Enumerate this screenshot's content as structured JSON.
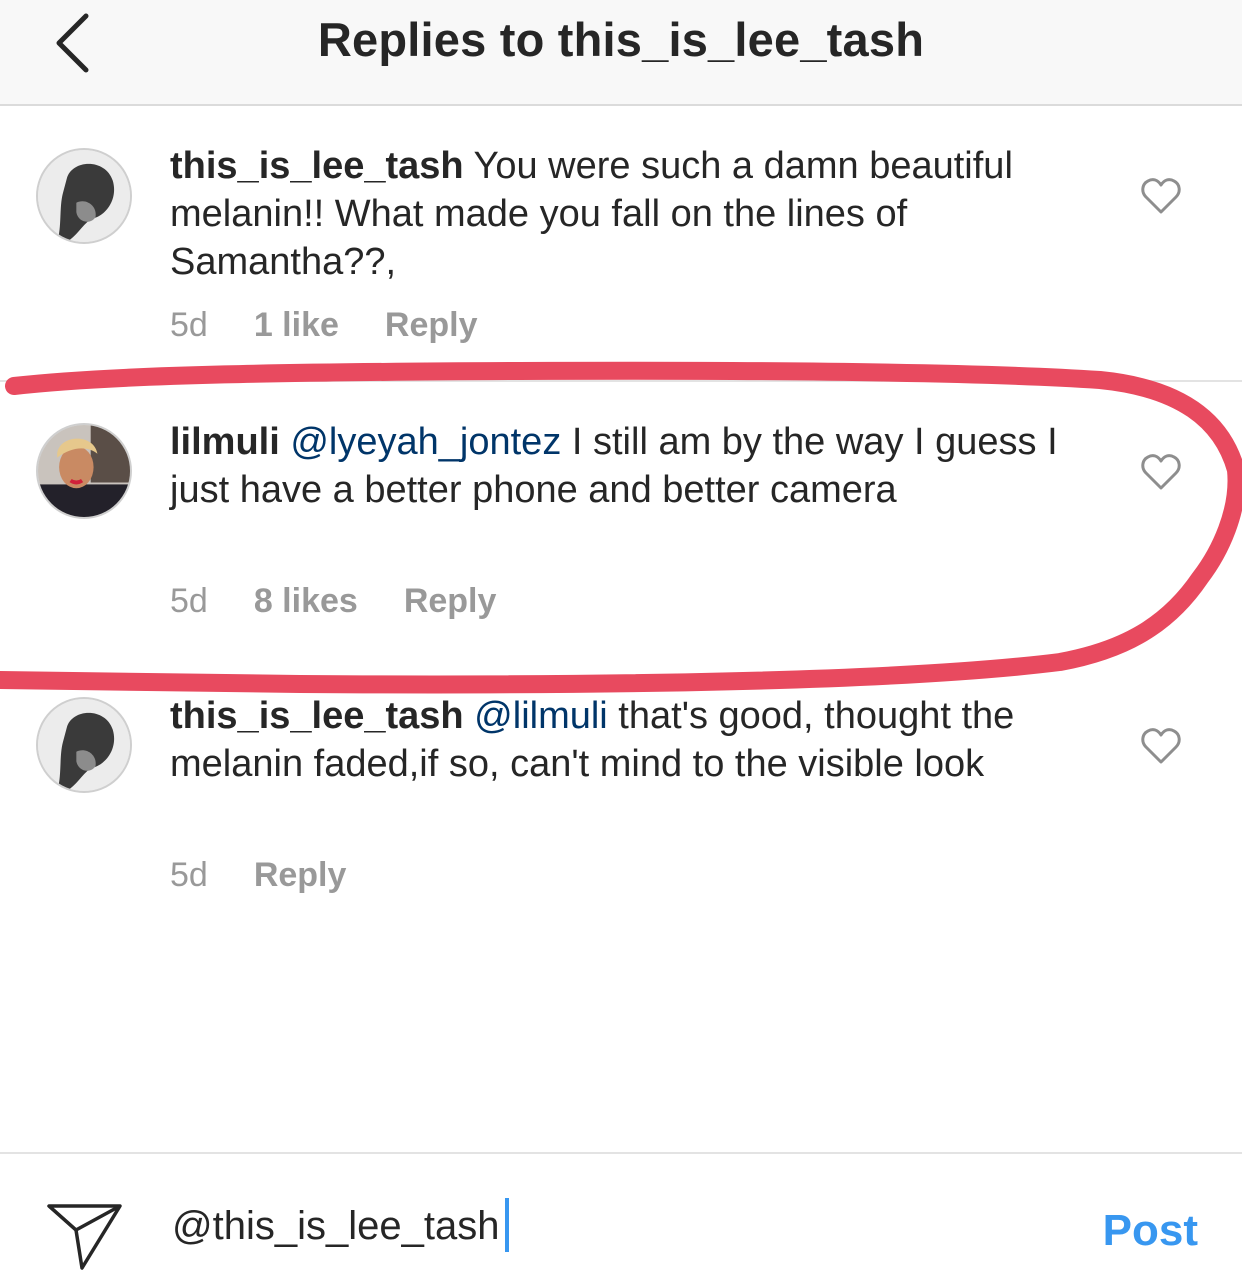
{
  "header": {
    "title": "Replies to this_is_lee_tash"
  },
  "comments": [
    {
      "username": "this_is_lee_tash",
      "mention": "",
      "text": " You were such a damn beautiful melanin!! What made you fall on the lines of Samantha??,",
      "age": "5d",
      "likes": "1 like",
      "reply": "Reply"
    },
    {
      "username": "lilmuli",
      "mention": "@lyeyah_jontez",
      "text": " I still am by the way I guess I just have a better phone and better camera",
      "age": "5d",
      "likes": "8 likes",
      "reply": "Reply"
    },
    {
      "username": "this_is_lee_tash",
      "mention": "@lilmuli",
      "text": " that's good, thought the melanin faded,if so, can't mind to the visible look",
      "age": "5d",
      "likes": "",
      "reply": "Reply"
    }
  ],
  "composer": {
    "value": "@this_is_lee_tash",
    "post_label": "Post"
  },
  "colors": {
    "accent": "#3897f0",
    "mention": "#003569",
    "annotation": "#e84a5f",
    "meta": "#999999"
  },
  "icons": [
    "chevron-left-icon",
    "heart-outline-icon",
    "paper-plane-icon"
  ]
}
